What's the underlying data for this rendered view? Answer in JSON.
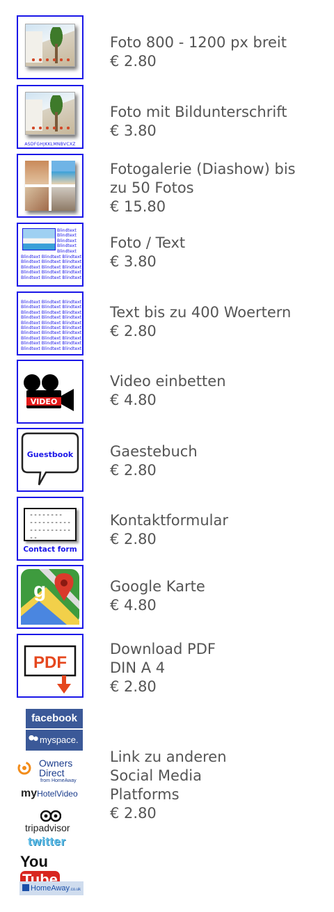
{
  "items": [
    {
      "label_lines": [
        "Foto 800 - 1200 px breit"
      ],
      "price": "€ 2.80",
      "icon": "photo-icon"
    },
    {
      "label_lines": [
        "Foto mit Bildunterschrift"
      ],
      "price": "€ 3.80",
      "icon": "photo-caption-icon",
      "caption": "ASDFGHJKKLMNBVCXZ"
    },
    {
      "label_lines": [
        "Fotogalerie (Diashow) bis",
        "zu 50 Fotos"
      ],
      "price": "€ 15.80",
      "icon": "gallery-icon"
    },
    {
      "label_lines": [
        "Foto / Text"
      ],
      "price": "€ 3.80",
      "icon": "photo-text-icon",
      "blindtext": "Blindtext"
    },
    {
      "label_lines": [
        "Text bis zu 400 Woertern"
      ],
      "price": "€ 2.80",
      "icon": "text-icon",
      "blindtext": "Blindtext"
    },
    {
      "label_lines": [
        "Video einbetten"
      ],
      "price": "€ 4.80",
      "icon": "video-camera-icon",
      "icon_text": "VIDEO"
    },
    {
      "label_lines": [
        "Gaestebuch"
      ],
      "price": "€ 2.80",
      "icon": "guestbook-icon",
      "icon_text": "Guestbook"
    },
    {
      "label_lines": [
        "Kontaktformular"
      ],
      "price": "€ 2.80",
      "icon": "contact-form-icon",
      "icon_text": "Contact form",
      "dashes": [
        "--------",
        "----------",
        "------------"
      ]
    },
    {
      "label_lines": [
        "Google Karte"
      ],
      "price": "€ 4.80",
      "icon": "google-maps-icon"
    },
    {
      "label_lines": [
        "Download PDF",
        "DIN A 4"
      ],
      "price": "€ 2.80",
      "icon": "pdf-download-icon",
      "icon_text": "PDF"
    }
  ],
  "social": {
    "label_lines": [
      "Link zu anderen",
      "Social Media",
      "Platforms"
    ],
    "price": "€ 2.80",
    "logos": {
      "facebook": "facebook",
      "myspace": "myspace.",
      "owners_direct_1": "Owners",
      "owners_direct_2": "Direct",
      "owners_direct_3": "from HomeAway",
      "myhotelvideo_my": "my",
      "myhotelvideo_rest": "HotelVideo",
      "tripadvisor": "tripadvisor",
      "twitter": "twitter",
      "youtube_you": "You",
      "youtube_tube": "Tube",
      "homeaway": "HomeAway",
      "homeaway_suffix": ".co.uk"
    }
  },
  "colors": {
    "border": "#1a16e8",
    "label": "#555555"
  }
}
